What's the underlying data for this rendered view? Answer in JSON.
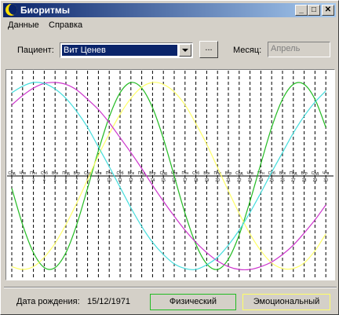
{
  "window": {
    "title": "Биоритмы"
  },
  "titlebar_buttons": {
    "minimize": "_",
    "maximize": "□",
    "close": "✕"
  },
  "menu": {
    "items": [
      "Данные",
      "Справка"
    ]
  },
  "patient": {
    "label": "Пациент:",
    "selected": "Вит Ценев",
    "browse_label": "..."
  },
  "month": {
    "label": "Месяц:",
    "value": "Апрель"
  },
  "footer": {
    "birth_label": "Дата рождения:",
    "birth_value": "15/12/1971",
    "legend_physical": "Физический",
    "legend_emotional": "Эмоциональный"
  },
  "colors": {
    "physical": "#22bb22",
    "emotional": "#ffff66",
    "intellectual": "#cc33cc",
    "intuitive": "#44dddd"
  },
  "chart_data": {
    "type": "line",
    "x_labels": [
      "Срд",
      "Чтв",
      "Птн",
      "Суб",
      "Вск",
      "Пнд",
      "Втр",
      "Срд",
      "Чтв",
      "Птн",
      "Суб",
      "Вск",
      "Пнд",
      "Втр",
      "Срд",
      "Чтв",
      "Птн",
      "Суб",
      "Вск",
      "Пнд",
      "Втр",
      "Срд",
      "Чтв",
      "Птн",
      "Суб",
      "Вск",
      "Пнд",
      "Втр",
      "Срд",
      "Чтв"
    ],
    "days": [
      "1",
      "2",
      "3",
      "4",
      "5",
      "6",
      "7",
      "8",
      "9",
      "10",
      "11",
      "12",
      "13",
      "14",
      "15",
      "16",
      "17",
      "18",
      "19",
      "20",
      "21",
      "22",
      "23",
      "24",
      "25",
      "26",
      "27",
      "28",
      "29",
      "30"
    ],
    "ylim": [
      -1,
      1
    ],
    "grid": "vertical dashed",
    "series": [
      {
        "name": "Физический",
        "color_key": "physical",
        "values": [
          -0.13,
          -0.52,
          -0.82,
          -0.98,
          -0.98,
          -0.82,
          -0.52,
          -0.13,
          0.27,
          0.63,
          0.89,
          1.0,
          0.94,
          0.73,
          0.4,
          0.0,
          -0.4,
          -0.73,
          -0.94,
          -1.0,
          -0.89,
          -0.63,
          -0.27,
          0.13,
          0.52,
          0.82,
          0.98,
          0.98,
          0.82,
          0.52
        ]
      },
      {
        "name": "Эмоциональный",
        "color_key": "emotional",
        "values": [
          -0.97,
          -1.0,
          -0.97,
          -0.87,
          -0.72,
          -0.52,
          -0.29,
          -0.04,
          0.22,
          0.45,
          0.66,
          0.83,
          0.95,
          1.0,
          0.98,
          0.9,
          0.76,
          0.56,
          0.34,
          0.09,
          -0.16,
          -0.4,
          -0.62,
          -0.8,
          -0.93,
          -0.99,
          -0.99,
          -0.93,
          -0.8,
          -0.62
        ]
      },
      {
        "values": [
          0.76,
          0.86,
          0.94,
          0.99,
          1.0,
          0.98,
          0.92,
          0.82,
          0.71,
          0.57,
          0.41,
          0.25,
          0.08,
          -0.1,
          -0.27,
          -0.43,
          -0.58,
          -0.71,
          -0.82,
          -0.91,
          -0.97,
          -1.0,
          -1.0,
          -0.97,
          -0.92,
          -0.84,
          -0.74,
          -0.61,
          -0.47,
          -0.31
        ]
      },
      {
        "values": [
          0.89,
          0.96,
          1.0,
          0.99,
          0.93,
          0.83,
          0.69,
          0.52,
          0.31,
          0.1,
          -0.12,
          -0.34,
          -0.54,
          -0.71,
          -0.84,
          -0.94,
          -0.99,
          -1.0,
          -0.95,
          -0.87,
          -0.74,
          -0.58,
          -0.39,
          -0.18,
          0.04,
          0.25,
          0.46,
          0.64,
          0.79,
          0.91
        ]
      }
    ]
  }
}
